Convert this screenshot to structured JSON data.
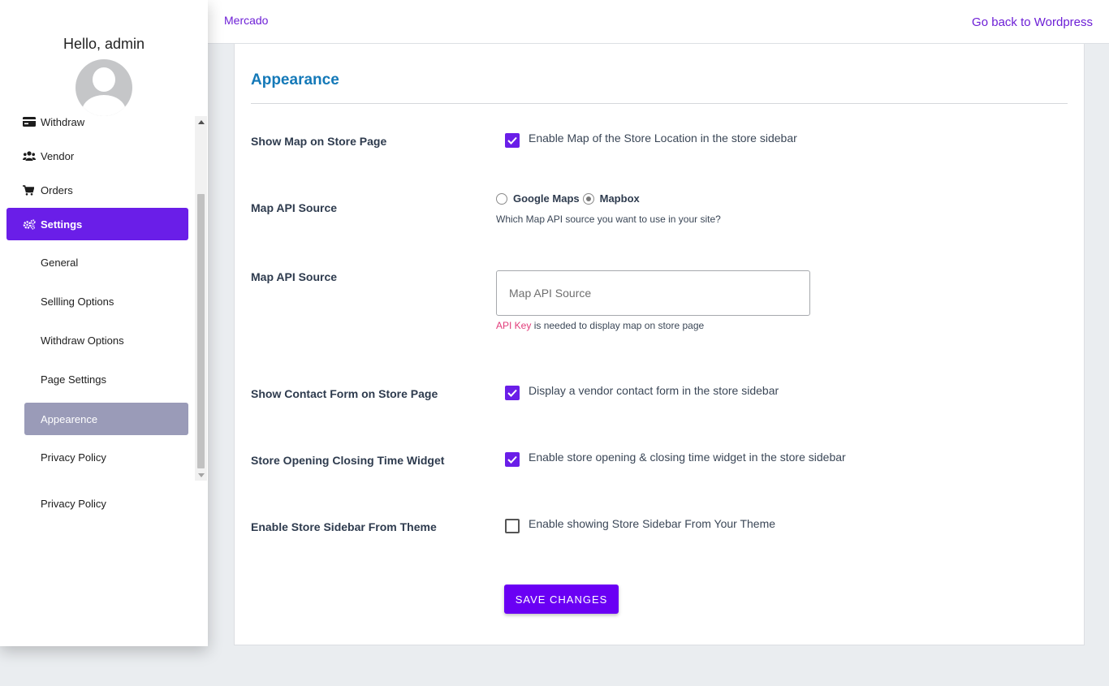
{
  "header": {
    "brand": "Mercado",
    "back_link": "Go back to Wordpress"
  },
  "sidebar": {
    "greeting": "Hello, admin",
    "items": [
      {
        "label": "Withdraw",
        "icon": "credit-card-icon"
      },
      {
        "label": "Vendor",
        "icon": "users-icon"
      },
      {
        "label": "Orders",
        "icon": "cart-icon"
      },
      {
        "label": "Settings",
        "icon": "gears-icon",
        "active": true
      }
    ],
    "sub_items": [
      {
        "label": "General"
      },
      {
        "label": "Sellling Options"
      },
      {
        "label": "Withdraw Options"
      },
      {
        "label": "Page Settings"
      },
      {
        "label": "Appearence",
        "active": true
      },
      {
        "label": "Privacy Policy"
      }
    ],
    "extra_item": "Privacy Policy"
  },
  "main": {
    "title": "Appearance",
    "show_map": {
      "label": "Show Map on Store Page",
      "checkbox_text": "Enable Map of the Store Location in the store sidebar",
      "checked": true
    },
    "map_source": {
      "label": "Map API Source",
      "options": [
        "Google Maps",
        "Mapbox"
      ],
      "selected": "Mapbox",
      "help": "Which Map API source you want to use in your site?"
    },
    "map_key": {
      "label": "Map API Source",
      "placeholder": "Map API Source",
      "value": "",
      "help_link": "API Key",
      "help_rest": " is needed to display map on store page"
    },
    "contact_form": {
      "label": "Show Contact Form on Store Page",
      "checkbox_text": "Display a vendor contact form in the store sidebar",
      "checked": true
    },
    "opening_widget": {
      "label": "Store Opening Closing Time Widget",
      "checkbox_text": "Enable store opening & closing time widget in the store sidebar",
      "checked": true
    },
    "theme_sidebar": {
      "label": "Enable Store Sidebar From Theme",
      "checkbox_text": "Enable showing Store Sidebar From Your Theme",
      "checked": false
    },
    "save_label": "SAVE CHANGES"
  },
  "colors": {
    "accent": "#6a1ee8",
    "title": "#1479b8",
    "link": "#6d1fd6",
    "api_key": "#e23c7a"
  }
}
